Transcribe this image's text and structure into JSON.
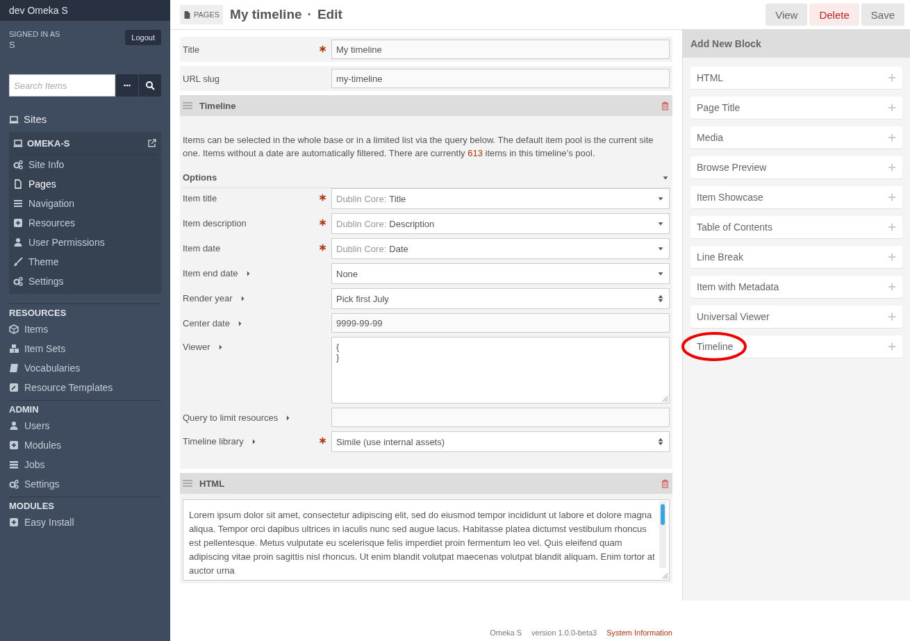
{
  "app_title": "dev Omeka S",
  "user": {
    "signed_in_label": "SIGNED IN AS",
    "name": "S",
    "logout": "Logout"
  },
  "search": {
    "placeholder": "Search Items"
  },
  "sites": {
    "label": "Sites",
    "site_name": "OMEKA-S",
    "items": [
      {
        "label": "Site Info",
        "selected": false
      },
      {
        "label": "Pages",
        "selected": true
      },
      {
        "label": "Navigation",
        "selected": false
      },
      {
        "label": "Resources",
        "selected": false
      },
      {
        "label": "User Permissions",
        "selected": false
      },
      {
        "label": "Theme",
        "selected": false
      },
      {
        "label": "Settings",
        "selected": false
      }
    ]
  },
  "sections": [
    {
      "heading": "RESOURCES",
      "items": [
        {
          "label": "Items"
        },
        {
          "label": "Item Sets"
        },
        {
          "label": "Vocabularies"
        },
        {
          "label": "Resource Templates"
        }
      ]
    },
    {
      "heading": "ADMIN",
      "items": [
        {
          "label": "Users"
        },
        {
          "label": "Modules"
        },
        {
          "label": "Jobs"
        },
        {
          "label": "Settings"
        }
      ]
    },
    {
      "heading": "MODULES",
      "items": [
        {
          "label": "Easy Install"
        }
      ]
    }
  ],
  "header": {
    "badge": "PAGES",
    "title": "My timeline",
    "separator": "·",
    "action": "Edit",
    "buttons": [
      {
        "label": "View",
        "kind": "default"
      },
      {
        "label": "Delete",
        "kind": "danger"
      },
      {
        "label": "Save",
        "kind": "default"
      }
    ]
  },
  "page_fields": [
    {
      "label": "Title",
      "required": true,
      "value": "My timeline"
    },
    {
      "label": "URL slug",
      "required": false,
      "value": "my-timeline"
    }
  ],
  "timeline_block": {
    "title": "Timeline",
    "description_before": "Items can be selected in the whole base or in a limited list via the query below. The default item pool is the current site one. Items without a date are automatically filtered. There are currently",
    "count": "613",
    "description_after": "items in this timeline’s pool.",
    "options_label": "Options",
    "options_expanded": true,
    "fields": [
      {
        "label": "Item title",
        "required": true,
        "info": false,
        "kind": "select",
        "prefix": "Dublin Core:",
        "value": "Title"
      },
      {
        "label": "Item description",
        "required": true,
        "info": false,
        "kind": "select",
        "prefix": "Dublin Core:",
        "value": "Description"
      },
      {
        "label": "Item date",
        "required": true,
        "info": false,
        "kind": "select",
        "prefix": "Dublin Core:",
        "value": "Date"
      },
      {
        "label": "Item end date",
        "required": false,
        "info": true,
        "kind": "select",
        "value": "None"
      },
      {
        "label": "Render year",
        "required": false,
        "info": true,
        "kind": "updown",
        "value": "Pick first July"
      },
      {
        "label": "Center date",
        "required": false,
        "info": true,
        "kind": "text",
        "value": "9999-99-99"
      },
      {
        "label": "Viewer",
        "required": false,
        "info": true,
        "kind": "textarea",
        "value": "{\n}"
      },
      {
        "label": "Query to limit resources",
        "required": false,
        "info": true,
        "kind": "text"
      },
      {
        "label": "Timeline library",
        "required": true,
        "info": true,
        "kind": "updown",
        "value": "Simile (use internal assets)"
      }
    ]
  },
  "html_block": {
    "title": "HTML",
    "text": "Lorem ipsum dolor sit amet, consectetur adipiscing elit, sed do eiusmod tempor incididunt ut labore et dolore magna aliqua. Tempor orci dapibus ultrices in iaculis nunc sed augue lacus. Habitasse platea dictumst vestibulum rhoncus est pellentesque. Metus vulputate eu scelerisque felis imperdiet proin fermentum leo vel. Quis eleifend quam adipiscing vitae proin sagittis nisl rhoncus. Ut enim blandit volutpat maecenas volutpat blandit aliquam. Enim tortor at auctor urna"
  },
  "add_block": {
    "title": "Add New Block",
    "items": [
      {
        "label": "HTML",
        "circled": false
      },
      {
        "label": "Page Title",
        "circled": false
      },
      {
        "label": "Media",
        "circled": false
      },
      {
        "label": "Browse Preview",
        "circled": false
      },
      {
        "label": "Item Showcase",
        "circled": false
      },
      {
        "label": "Table of Contents",
        "circled": false
      },
      {
        "label": "Line Break",
        "circled": false
      },
      {
        "label": "Item with Metadata",
        "circled": false
      },
      {
        "label": "Universal Viewer",
        "circled": false
      },
      {
        "label": "Timeline",
        "circled": true
      }
    ]
  },
  "footer": {
    "product": "Omeka S",
    "version": "version 1.0.0-beta3",
    "link": "System Information"
  }
}
